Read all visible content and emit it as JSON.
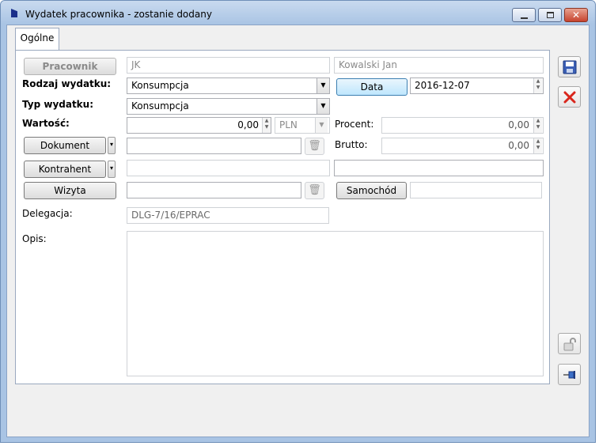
{
  "window": {
    "title": "Wydatek pracownika - zostanie dodany"
  },
  "tabs": [
    {
      "label": "Ogólne"
    }
  ],
  "form": {
    "pracownik_button": "Pracownik",
    "pracownik_code": "JK",
    "pracownik_name": "Kowalski Jan",
    "rodzaj_label": "Rodzaj wydatku:",
    "rodzaj_value": "Konsumpcja",
    "data_button": "Data",
    "data_value": "2016-12-07",
    "typ_label": "Typ wydatku:",
    "typ_value": "Konsumpcja",
    "wartosc_label": "Wartość:",
    "wartosc_value": "0,00",
    "currency": "PLN",
    "procent_label": "Procent:",
    "procent_value": "0,00",
    "dokument_button": "Dokument",
    "dokument_value": "",
    "brutto_label": "Brutto:",
    "brutto_value": "0,00",
    "kontrahent_button": "Kontrahent",
    "kontrahent_code": "",
    "kontrahent_name": "",
    "wizyta_button": "Wizyta",
    "wizyta_value": "",
    "samochod_button": "Samochód",
    "samochod_value": "",
    "delegacja_label": "Delegacja:",
    "delegacja_value": "DLG-7/16/EPRAC",
    "opis_label": "Opis:",
    "opis_value": ""
  },
  "icons": {
    "save": "save-icon",
    "cancel": "cancel-icon",
    "lock": "unlock-icon",
    "pin": "pin-icon",
    "trash": "trash-icon",
    "dropdown": "chevron-down-icon"
  },
  "colors": {
    "titlebar": "#a9c4e4",
    "accent": "#3c7fb1",
    "cancel_red": "#d9261c"
  }
}
